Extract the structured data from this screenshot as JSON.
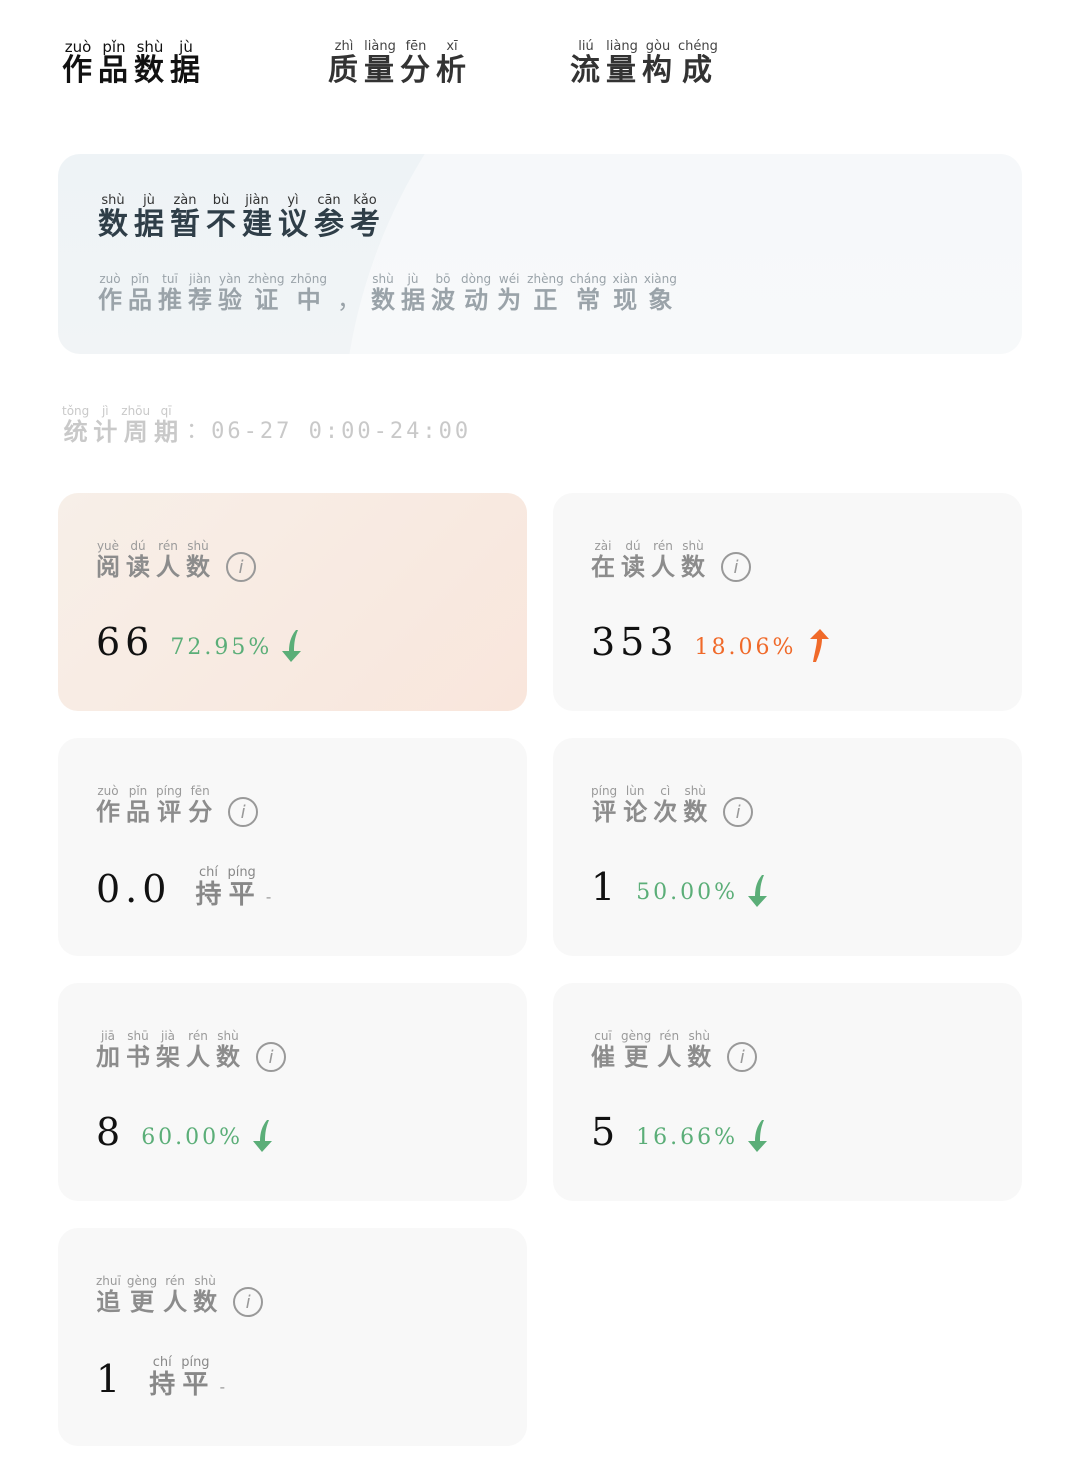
{
  "tabs": [
    {
      "label": "作品数据",
      "pinyin": [
        "zuò",
        "pǐn",
        "shù",
        "jù"
      ],
      "active": true
    },
    {
      "label": "质量分析",
      "pinyin": [
        "zhì",
        "liàng",
        "fēn",
        "xī"
      ],
      "active": false
    },
    {
      "label": "流量构成",
      "pinyin": [
        "liú",
        "liàng",
        "gòu",
        "chéng"
      ],
      "active": false
    }
  ],
  "banner": {
    "title": "数据暂不建议参考",
    "title_pinyin": [
      "shù",
      "jù",
      "zàn",
      "bù",
      "jiàn",
      "yì",
      "cān",
      "kǎo"
    ],
    "subtitle_part1": "作品推荐验证中",
    "subtitle_part1_pinyin": [
      "zuò",
      "pǐn",
      "tuī",
      "jiàn",
      "yàn",
      "zhèng",
      "zhōng"
    ],
    "separator": "，",
    "subtitle_part2": "数据波动为正常现象",
    "subtitle_part2_pinyin": [
      "shù",
      "jù",
      "bō",
      "dòng",
      "wéi",
      "zhèng",
      "cháng",
      "xiàn",
      "xiàng"
    ]
  },
  "period": {
    "label": "统计周期",
    "label_pinyin": [
      "tǒng",
      "jì",
      "zhōu",
      "qī"
    ],
    "colon": "：",
    "value": "06-27 0:00-24:00"
  },
  "colors": {
    "down": "#5bae78",
    "up": "#f06a2a"
  },
  "metrics": [
    {
      "label": "阅读人数",
      "pinyin": [
        "yuè",
        "dú",
        "rén",
        "shù"
      ],
      "value": "66",
      "change": "72.95%",
      "trend": "down",
      "highlight": true
    },
    {
      "label": "在读人数",
      "pinyin": [
        "zài",
        "dú",
        "rén",
        "shù"
      ],
      "value": "353",
      "change": "18.06%",
      "trend": "up",
      "highlight": false
    },
    {
      "label": "作品评分",
      "pinyin": [
        "zuò",
        "pǐn",
        "píng",
        "fēn"
      ],
      "value": "0.0",
      "change": "",
      "trend": "flat",
      "flat_label": "持平",
      "flat_pinyin": [
        "chí",
        "píng"
      ],
      "flat_dash": "-",
      "highlight": false
    },
    {
      "label": "评论次数",
      "pinyin": [
        "píng",
        "lùn",
        "cì",
        "shù"
      ],
      "value": "1",
      "change": "50.00%",
      "trend": "down",
      "highlight": false
    },
    {
      "label": "加书架人数",
      "pinyin": [
        "jiā",
        "shū",
        "jià",
        "rén",
        "shù"
      ],
      "value": "8",
      "change": "60.00%",
      "trend": "down",
      "highlight": false
    },
    {
      "label": "催更人数",
      "pinyin": [
        "cuī",
        "gèng",
        "rén",
        "shù"
      ],
      "value": "5",
      "change": "16.66%",
      "trend": "down",
      "highlight": false
    },
    {
      "label": "追更人数",
      "pinyin": [
        "zhuī",
        "gèng",
        "rén",
        "shù"
      ],
      "value": "1",
      "change": "",
      "trend": "flat",
      "flat_label": "持平",
      "flat_pinyin": [
        "chí",
        "píng"
      ],
      "flat_dash": "-",
      "highlight": false
    }
  ],
  "icons": {
    "info": "info-icon",
    "down": "arrow-down-icon",
    "up": "arrow-up-icon"
  }
}
